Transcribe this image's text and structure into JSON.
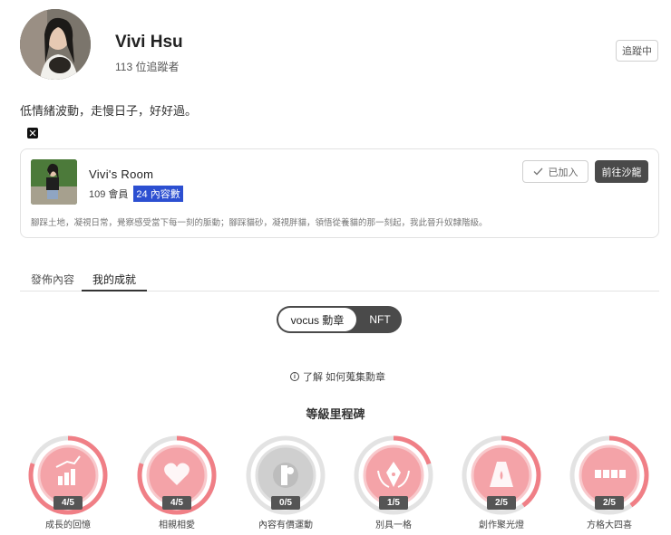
{
  "profile": {
    "name": "Vivi Hsu",
    "followers": "113 位追蹤者",
    "follow_label": "追蹤中",
    "bio": "低情緒波動，走慢日子，好好過。",
    "social_icon": "x-icon"
  },
  "room": {
    "name": "Vivi's Room",
    "members": "109 會員",
    "posts": "24 內容數",
    "joined_label": "已加入",
    "goto_label": "前往沙龍",
    "description": "腳踩土地，凝視日常，覺察感受當下每一刻的脈動；腳踩貓砂，凝視胖貓，領悟從養貓的那一刻起，我此晉升奴隸階級。"
  },
  "tabs": [
    {
      "label": "發佈內容",
      "active": false
    },
    {
      "label": "我的成就",
      "active": true
    }
  ],
  "toggle": {
    "left_label": "vocus 勳章",
    "right_label": "NFT"
  },
  "learn_label": "了解 如何蒐集勳章",
  "section_title": "等級里程碑",
  "colors": {
    "accent_pink": "#f07f86",
    "badge_pink": "#f4a3a8",
    "dark": "#4a4a4a",
    "highlight_blue": "#2c4fd1"
  },
  "badges": [
    {
      "name": "成長的回憶",
      "count": "4/5",
      "progress": 0.8,
      "icon": "growth-chart-icon",
      "earned": true
    },
    {
      "name": "相親相愛",
      "count": "4/5",
      "progress": 0.8,
      "icon": "hearts-icon",
      "earned": true
    },
    {
      "name": "內容有價運動",
      "count": "0/5",
      "progress": 0.0,
      "icon": "coin-icon",
      "earned": false
    },
    {
      "name": "別具一格",
      "count": "1/5",
      "progress": 0.2,
      "icon": "pen-nib-icon",
      "earned": true
    },
    {
      "name": "創作聚光燈",
      "count": "2/5",
      "progress": 0.4,
      "icon": "spotlight-icon",
      "earned": true
    },
    {
      "name": "方格大四喜",
      "count": "2/5",
      "progress": 0.4,
      "icon": "grid-squares-icon",
      "earned": true
    }
  ]
}
